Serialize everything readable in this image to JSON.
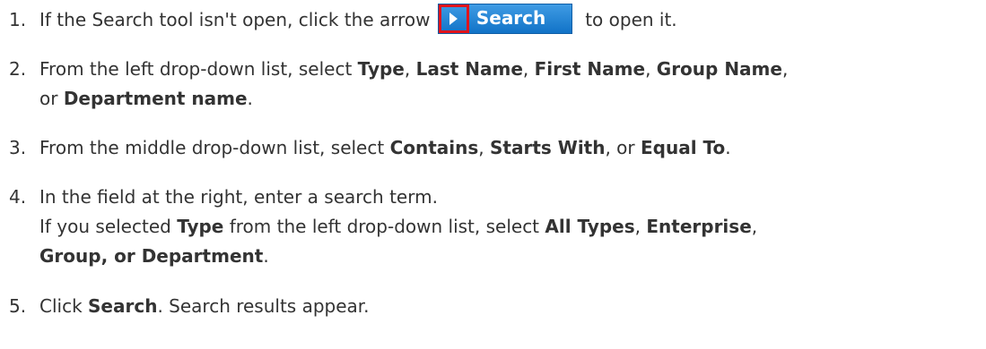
{
  "steps": [
    {
      "number": "1.",
      "text_before": "If the Search tool isn't open, click the arrow",
      "button_label": "Search",
      "text_after": "to open it."
    },
    {
      "number": "2.",
      "lines": [
        [
          {
            "t": "From the left drop-down list, select ",
            "b": false
          },
          {
            "t": "Type",
            "b": true
          },
          {
            "t": ", ",
            "b": false
          },
          {
            "t": "Last Name",
            "b": true
          },
          {
            "t": ", ",
            "b": false
          },
          {
            "t": "First Name",
            "b": true
          },
          {
            "t": ", ",
            "b": false
          },
          {
            "t": "Group Name",
            "b": true
          },
          {
            "t": ",",
            "b": false
          }
        ],
        [
          {
            "t": "or ",
            "b": false
          },
          {
            "t": "Department name",
            "b": true
          },
          {
            "t": ".",
            "b": false
          }
        ]
      ]
    },
    {
      "number": "3.",
      "lines": [
        [
          {
            "t": "From the middle drop-down list, select ",
            "b": false
          },
          {
            "t": "Contains",
            "b": true
          },
          {
            "t": ", ",
            "b": false
          },
          {
            "t": "Starts With",
            "b": true
          },
          {
            "t": ", or ",
            "b": false
          },
          {
            "t": "Equal To",
            "b": true
          },
          {
            "t": ".",
            "b": false
          }
        ]
      ]
    },
    {
      "number": "4.",
      "lines": [
        [
          {
            "t": "In the field at the right, enter a search term.",
            "b": false
          }
        ],
        [
          {
            "t": "If you selected ",
            "b": false
          },
          {
            "t": "Type",
            "b": true
          },
          {
            "t": " from the left drop-down list, select ",
            "b": false
          },
          {
            "t": "All Types",
            "b": true
          },
          {
            "t": ", ",
            "b": false
          },
          {
            "t": "Enterprise",
            "b": true
          },
          {
            "t": ",",
            "b": false
          }
        ],
        [
          {
            "t": "Group, or Department",
            "b": true
          },
          {
            "t": ".",
            "b": false
          }
        ]
      ]
    },
    {
      "number": "5.",
      "lines": [
        [
          {
            "t": "Click ",
            "b": false
          },
          {
            "t": "Search",
            "b": true
          },
          {
            "t": ". Search results appear.",
            "b": false
          }
        ]
      ]
    }
  ],
  "colors": {
    "button_bg": "#1a7fd4",
    "highlight_border": "#e0141c",
    "text": "#333333"
  },
  "icons": {
    "expand": "play-arrow-icon"
  }
}
